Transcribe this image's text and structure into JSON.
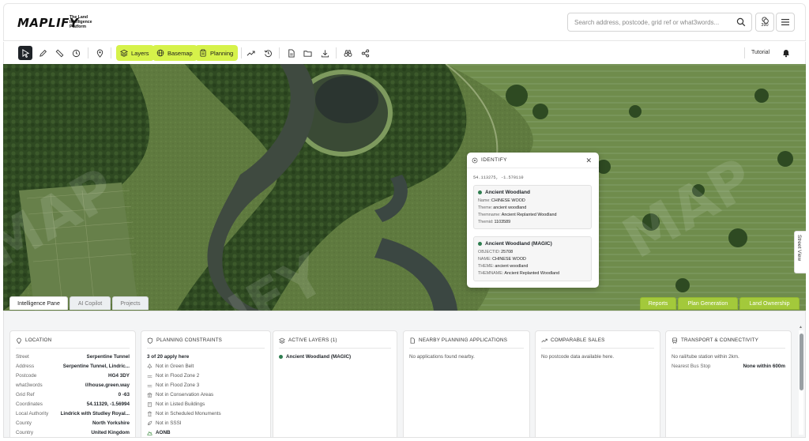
{
  "header": {
    "logo": "MAPLIFY",
    "tagline": "The Land Intelligence Platform",
    "search_placeholder": "Search address, postcode, grid ref or what3words...",
    "credits": "390"
  },
  "toolbar": {
    "layers_label": "Layers",
    "basemap_label": "Basemap",
    "planning_label": "Planning",
    "tutorial_label": "Tutorial"
  },
  "map": {
    "street_view_label": "Street View",
    "identify": {
      "title": "IDENTIFY",
      "coords": "54.113275, -1.570110",
      "result1": {
        "title": "Ancient Woodland",
        "rows": [
          {
            "k": "Name:",
            "v": "CHINESE WOOD"
          },
          {
            "k": "Theme:",
            "v": "ancient woodland"
          },
          {
            "k": "Themname:",
            "v": "Ancient Replanted Woodland"
          },
          {
            "k": "Themid:",
            "v": "1103589"
          }
        ]
      },
      "result2": {
        "title": "Ancient Woodland (MAGIC)",
        "rows": [
          {
            "k": "OBJECTID:",
            "v": "25708"
          },
          {
            "k": "NAME:",
            "v": "CHINESE WOOD"
          },
          {
            "k": "THEME:",
            "v": "ancient woodland"
          },
          {
            "k": "THEMNAME:",
            "v": "Ancient Replanted Woodland"
          }
        ]
      }
    },
    "tabs": [
      "Intelligence Pane",
      "AI Copilot",
      "Projects"
    ],
    "actions": [
      "Reports",
      "Plan Generation",
      "Land Ownership"
    ],
    "accent": "#d6f24a"
  },
  "pane": {
    "location": {
      "title": "LOCATION",
      "rows": [
        {
          "k": "Street",
          "v": "Serpentine Tunnel"
        },
        {
          "k": "Address",
          "v": "Serpentine Tunnel, Lindric..."
        },
        {
          "k": "Postcode",
          "v": "HG4 3DY"
        },
        {
          "k": "what3words",
          "v": "///house.green.way"
        },
        {
          "k": "Grid Ref",
          "v": "0 -63"
        },
        {
          "k": "Coordinates",
          "v": "54.11329, -1.56994"
        },
        {
          "k": "Local Authority",
          "v": "Lindrick with Studley Royal..."
        },
        {
          "k": "County",
          "v": "North Yorkshire"
        },
        {
          "k": "Country",
          "v": "United Kingdom"
        }
      ]
    },
    "planning": {
      "title": "PLANNING CONSTRAINTS",
      "summary": "3 of 20 apply here",
      "items": [
        "Not in Green Belt",
        "Not in Flood Zone 2",
        "Not in Flood Zone 3",
        "Not in Conservation Areas",
        "Not in Listed Buildings",
        "Not in Scheduled Monuments",
        "Not in SSSI"
      ],
      "applies": "AONB"
    },
    "layers": {
      "title": "ACTIVE LAYERS (1)",
      "items": [
        "Ancient Woodland (MAGIC)"
      ]
    },
    "nearby": {
      "title": "NEARBY PLANNING APPLICATIONS",
      "text": "No applications found nearby."
    },
    "sales": {
      "title": "COMPARABLE SALES",
      "text": "No postcode data available here."
    },
    "transport": {
      "title": "TRANSPORT & CONNECTIVITY",
      "text": "No rail/tube station within 2km.",
      "bus_k": "Nearest Bus Stop",
      "bus_v": "None within 600m"
    }
  }
}
